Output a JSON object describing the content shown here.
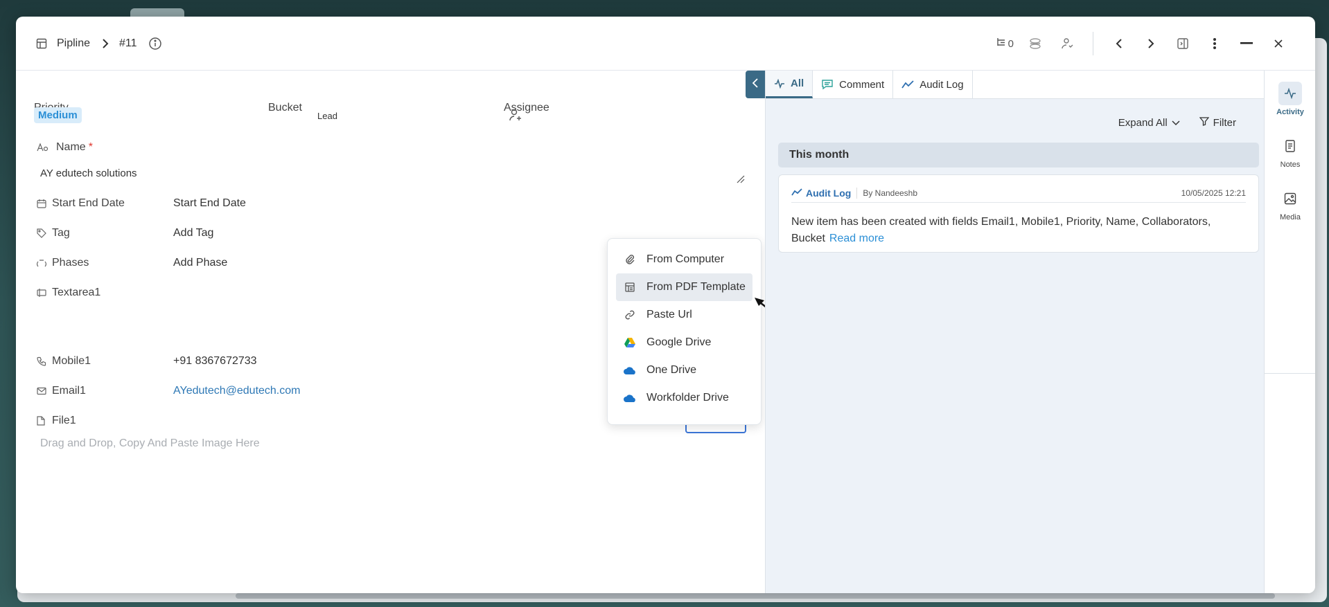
{
  "header": {
    "breadcrumb_root": "Pipline",
    "record_id": "#11",
    "counter_value": "0"
  },
  "form": {
    "priority_label": "Priority",
    "priority_value": "Medium",
    "bucket_label": "Bucket",
    "bucket_value": "Lead",
    "assignee_label": "Assignee",
    "name_label": "Name",
    "name_required": "*",
    "name_value": "AY edutech solutions",
    "start_end_label": "Start End Date",
    "start_end_value": "Start End Date",
    "tag_label": "Tag",
    "tag_value": "Add Tag",
    "phases_label": "Phases",
    "phases_value": "Add Phase",
    "textarea_label": "Textarea1",
    "mobile_label": "Mobile1",
    "mobile_value": "+91 8367672733",
    "email_label": "Email1",
    "email_value": "AYedutech@edutech.com",
    "file_label": "File1",
    "file_placeholder": "Drag and Drop, Copy And Paste Image Here"
  },
  "upload_menu": {
    "items": [
      {
        "label": "From Computer",
        "icon": "paperclip-icon"
      },
      {
        "label": "From PDF Template",
        "icon": "template-icon"
      },
      {
        "label": "Paste Url",
        "icon": "link-icon"
      },
      {
        "label": "Google Drive",
        "icon": "google-drive-icon"
      },
      {
        "label": "One Drive",
        "icon": "onedrive-icon"
      },
      {
        "label": "Workfolder Drive",
        "icon": "workfolder-drive-icon"
      }
    ],
    "highlighted_index": 1
  },
  "activity": {
    "tabs": [
      {
        "label": "All"
      },
      {
        "label": "Comment"
      },
      {
        "label": "Audit Log"
      }
    ],
    "active_tab": "All",
    "expand_all": "Expand All",
    "filter": "Filter",
    "group_title": "This month",
    "entry": {
      "type": "Audit Log",
      "author": "By Nandeeshb",
      "date": "10/05/2025 12:21",
      "text": "New item has been created with fields Email1, Mobile1, Priority, Name, Collaborators, Bucket",
      "read_more": "Read more"
    }
  },
  "sidebar": {
    "items": [
      {
        "label": "Activity",
        "icon": "activity-icon"
      },
      {
        "label": "Notes",
        "icon": "notes-icon"
      },
      {
        "label": "Media",
        "icon": "media-icon"
      }
    ],
    "active": "Activity"
  },
  "colors": {
    "accent": "#3a6a86",
    "priority_badge_bg": "#d8ecfa",
    "priority_badge_text": "#2b8fd6",
    "link": "#2e78b5",
    "required": "#e0372f"
  }
}
